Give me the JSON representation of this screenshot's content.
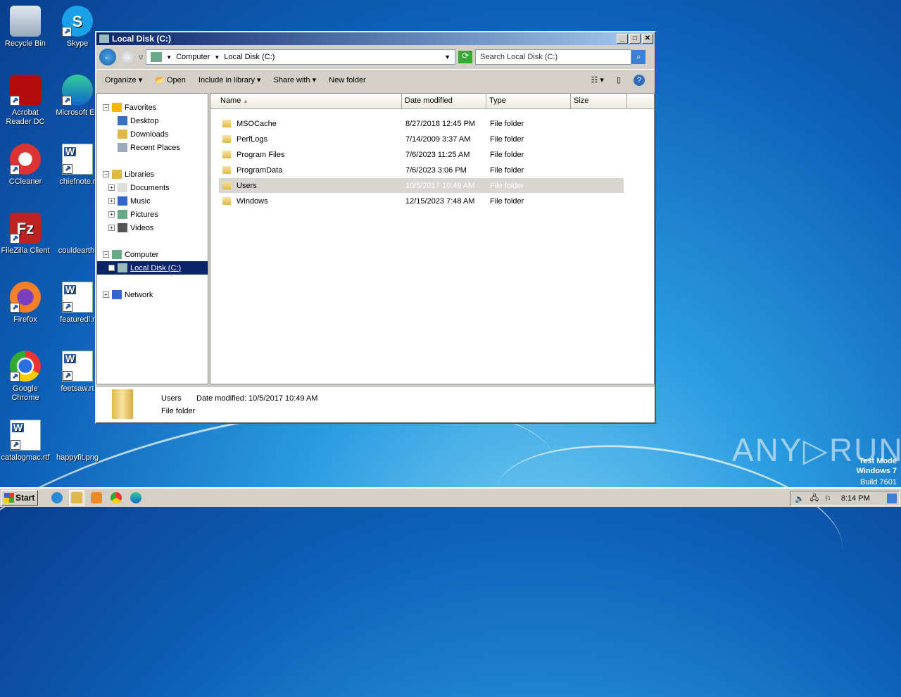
{
  "desktop": {
    "icons": [
      {
        "label": "Recycle Bin",
        "icon": "recycle-bin-icon"
      },
      {
        "label": "Skype",
        "icon": "skype-icon"
      },
      {
        "label": "Acrobat Reader DC",
        "icon": "acrobat-icon"
      },
      {
        "label": "Microsoft Ed",
        "icon": "edge-icon"
      },
      {
        "label": "CCleaner",
        "icon": "ccleaner-icon"
      },
      {
        "label": "chiefnote.r",
        "icon": "word-doc-icon"
      },
      {
        "label": "FileZilla Client",
        "icon": "filezilla-icon"
      },
      {
        "label": "couldearth.",
        "icon": "file-icon"
      },
      {
        "label": "Firefox",
        "icon": "firefox-icon"
      },
      {
        "label": "featuredl.r",
        "icon": "word-doc-icon"
      },
      {
        "label": "Google Chrome",
        "icon": "chrome-icon"
      },
      {
        "label": "feetsaw.rt",
        "icon": "word-doc-icon"
      },
      {
        "label": "catalogmac.rtf",
        "icon": "word-doc-icon"
      },
      {
        "label": "happyfit.png",
        "icon": "image-icon"
      }
    ]
  },
  "window": {
    "title": "Local Disk (C:)",
    "address": {
      "crumbs": [
        "Computer",
        "Local Disk (C:)"
      ],
      "search_placeholder": "Search Local Disk (C:)"
    },
    "toolbar": {
      "organize": "Organize",
      "open": "Open",
      "include": "Include in library",
      "share": "Share with",
      "new_folder": "New folder"
    },
    "nav": {
      "favorites": "Favorites",
      "desktop": "Desktop",
      "downloads": "Downloads",
      "recent": "Recent Places",
      "libraries": "Libraries",
      "documents": "Documents",
      "music": "Music",
      "pictures": "Pictures",
      "videos": "Videos",
      "computer": "Computer",
      "local_disk": "Local Disk (C:)",
      "network": "Network"
    },
    "columns": [
      "Name",
      "Date modified",
      "Type",
      "Size"
    ],
    "files": [
      {
        "name": "MSOCache",
        "date": "8/27/2018 12:45 PM",
        "type": "File folder"
      },
      {
        "name": "PerfLogs",
        "date": "7/14/2009 3:37 AM",
        "type": "File folder"
      },
      {
        "name": "Program Files",
        "date": "7/6/2023 11:25 AM",
        "type": "File folder"
      },
      {
        "name": "ProgramData",
        "date": "7/6/2023 3:06 PM",
        "type": "File folder"
      },
      {
        "name": "Users",
        "date": "10/5/2017 10:49 AM",
        "type": "File folder"
      },
      {
        "name": "Windows",
        "date": "12/15/2023 7:48 AM",
        "type": "File folder"
      }
    ],
    "details": {
      "name": "Users",
      "date_label": "Date modified:",
      "date": "10/5/2017 10:49 AM",
      "type": "File folder"
    }
  },
  "taskbar": {
    "start": "Start",
    "clock": "8:14 PM"
  },
  "watermark": {
    "logo": "ANY RUN",
    "line1": "Test Mode",
    "line2": "Windows 7",
    "line3": "Build 7601"
  }
}
